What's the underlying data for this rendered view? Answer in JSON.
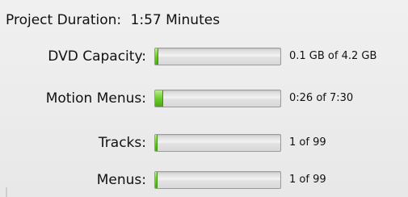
{
  "project_duration": {
    "label": "Project Duration:",
    "value": "1:57 Minutes"
  },
  "meters": [
    {
      "label": "DVD Capacity:",
      "value_text": "0.1 GB of 4.2 GB",
      "fill_fraction": 0.02
    },
    {
      "label": "Motion Menus:",
      "value_text": "0:26 of 7:30",
      "fill_fraction": 0.058
    },
    {
      "label": "Tracks:",
      "value_text": "1 of 99",
      "fill_fraction": 0.01
    },
    {
      "label": "Menus:",
      "value_text": "1 of 99",
      "fill_fraction": 0.01
    }
  ],
  "colors": {
    "meter_fill": "#6ccc2a",
    "background": "#ececec"
  }
}
